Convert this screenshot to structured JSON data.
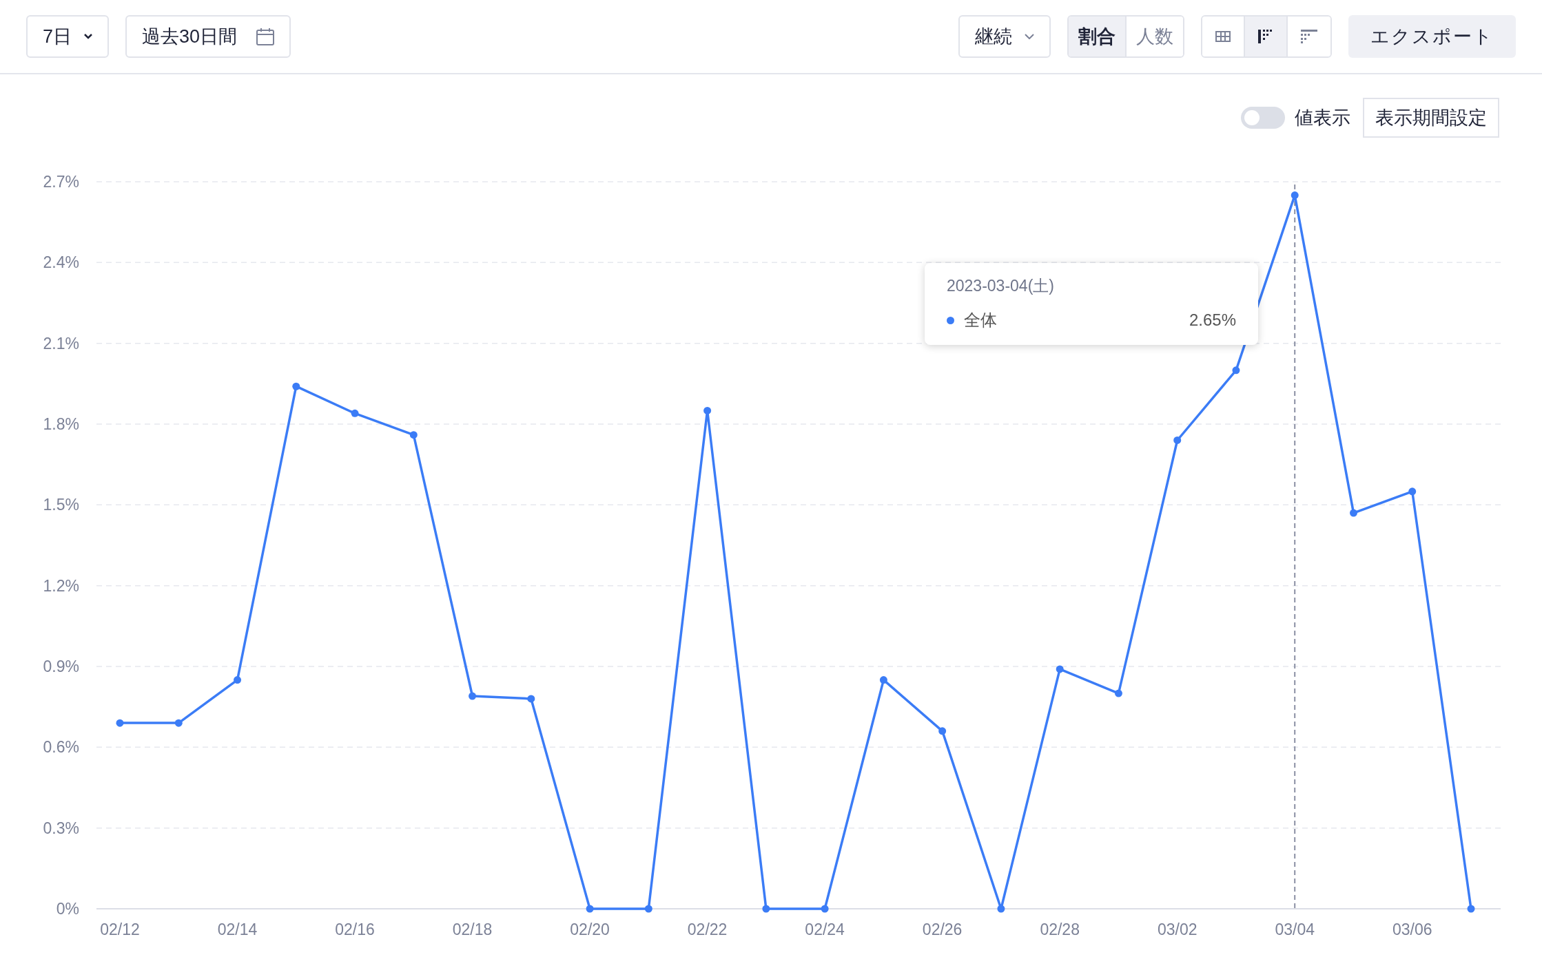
{
  "toolbar": {
    "period_select": {
      "value": "7日"
    },
    "date_range": {
      "value": "過去30日間"
    },
    "metric_select": {
      "value": "継続"
    },
    "mode_tabs": [
      {
        "label": "割合",
        "selected": true
      },
      {
        "label": "人数",
        "selected": false
      }
    ],
    "view_buttons": [
      {
        "kind": "table",
        "selected": false
      },
      {
        "kind": "bars",
        "selected": true
      },
      {
        "kind": "steps",
        "selected": false
      }
    ],
    "export_button": "エクスポート"
  },
  "chart_controls": {
    "value_toggle": {
      "label": "値表示",
      "on": false
    },
    "period_button": "表示期間設定"
  },
  "chart": {
    "chart_data": {
      "type": "line",
      "categories": [
        "02/12",
        null,
        "02/14",
        null,
        "02/16",
        null,
        "02/18",
        null,
        "02/20",
        null,
        "02/22",
        null,
        "02/24",
        null,
        "02/26",
        null,
        "02/28",
        null,
        "03/02",
        null,
        "03/04",
        null,
        "03/06",
        null
      ],
      "grid": true,
      "ref_lines": [
        {
          "axis": "x",
          "value": "03/04"
        }
      ],
      "series": [
        {
          "name": "全体",
          "color": "#3b7cf6",
          "marker": true,
          "values": [
            0.69,
            0.69,
            0.85,
            1.94,
            1.84,
            1.76,
            0.79,
            0.78,
            0,
            0,
            1.85,
            0,
            0,
            0.85,
            0.66,
            0,
            0.89,
            0.8,
            1.74,
            2.0,
            2.65,
            1.47,
            1.55,
            0
          ]
        }
      ],
      "ylim": [
        0,
        2.7
      ],
      "yticks": [
        {
          "value": 0,
          "label": "0%"
        },
        {
          "value": 0.3,
          "label": "0.3%"
        },
        {
          "value": 0.6,
          "label": "0.6%"
        },
        {
          "value": 0.9,
          "label": "0.9%"
        },
        {
          "value": 1.2,
          "label": "1.2%"
        },
        {
          "value": 1.5,
          "label": "1.5%"
        },
        {
          "value": 1.8,
          "label": "1.8%"
        },
        {
          "value": 2.1,
          "label": "2.1%"
        },
        {
          "value": 2.4,
          "label": "2.4%"
        },
        {
          "value": 2.7,
          "label": "2.7%"
        }
      ],
      "data_labels": false
    },
    "tooltip": {
      "title": "2023-03-04(土)",
      "rows": [
        {
          "value": "2.65%"
        }
      ]
    }
  }
}
